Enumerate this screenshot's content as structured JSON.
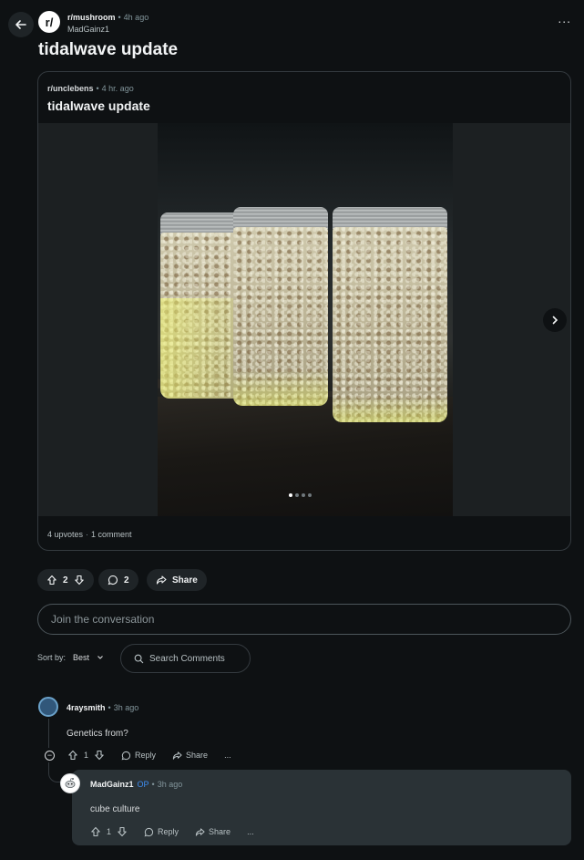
{
  "header": {
    "subreddit": "r/mushroom",
    "time": "4h ago",
    "author": "MadGainz1",
    "more_label": "...",
    "back_icon": "arrow-left-icon"
  },
  "post": {
    "title": "tidalwave update"
  },
  "crosspost": {
    "subreddit": "r/unclebens",
    "time": "4 hr. ago",
    "title": "tidalwave update",
    "upvotes": "4 upvotes",
    "comments": "1 comment",
    "gallery_count": 4,
    "gallery_index": 1
  },
  "actions": {
    "votes": "2",
    "comments": "2",
    "share": "Share"
  },
  "join": {
    "placeholder": "Join the conversation"
  },
  "sort": {
    "label": "Sort by:",
    "value": "Best",
    "search_placeholder": "Search Comments"
  },
  "comments": [
    {
      "author": "4raysmith",
      "time": "3h ago",
      "text": "Genetics from?",
      "votes": "1",
      "reply": "Reply",
      "share": "Share",
      "more": "..."
    }
  ],
  "reply": {
    "author": "MadGainz1",
    "badge": "OP",
    "time": "3h ago",
    "text": "cube culture",
    "votes": "1",
    "reply": "Reply",
    "share": "Share",
    "more": "..."
  },
  "colors": {
    "background": "#0e1113",
    "pill": "#1f2427",
    "op_badge": "#3d8cf0",
    "reply_card": "#2a3236"
  }
}
